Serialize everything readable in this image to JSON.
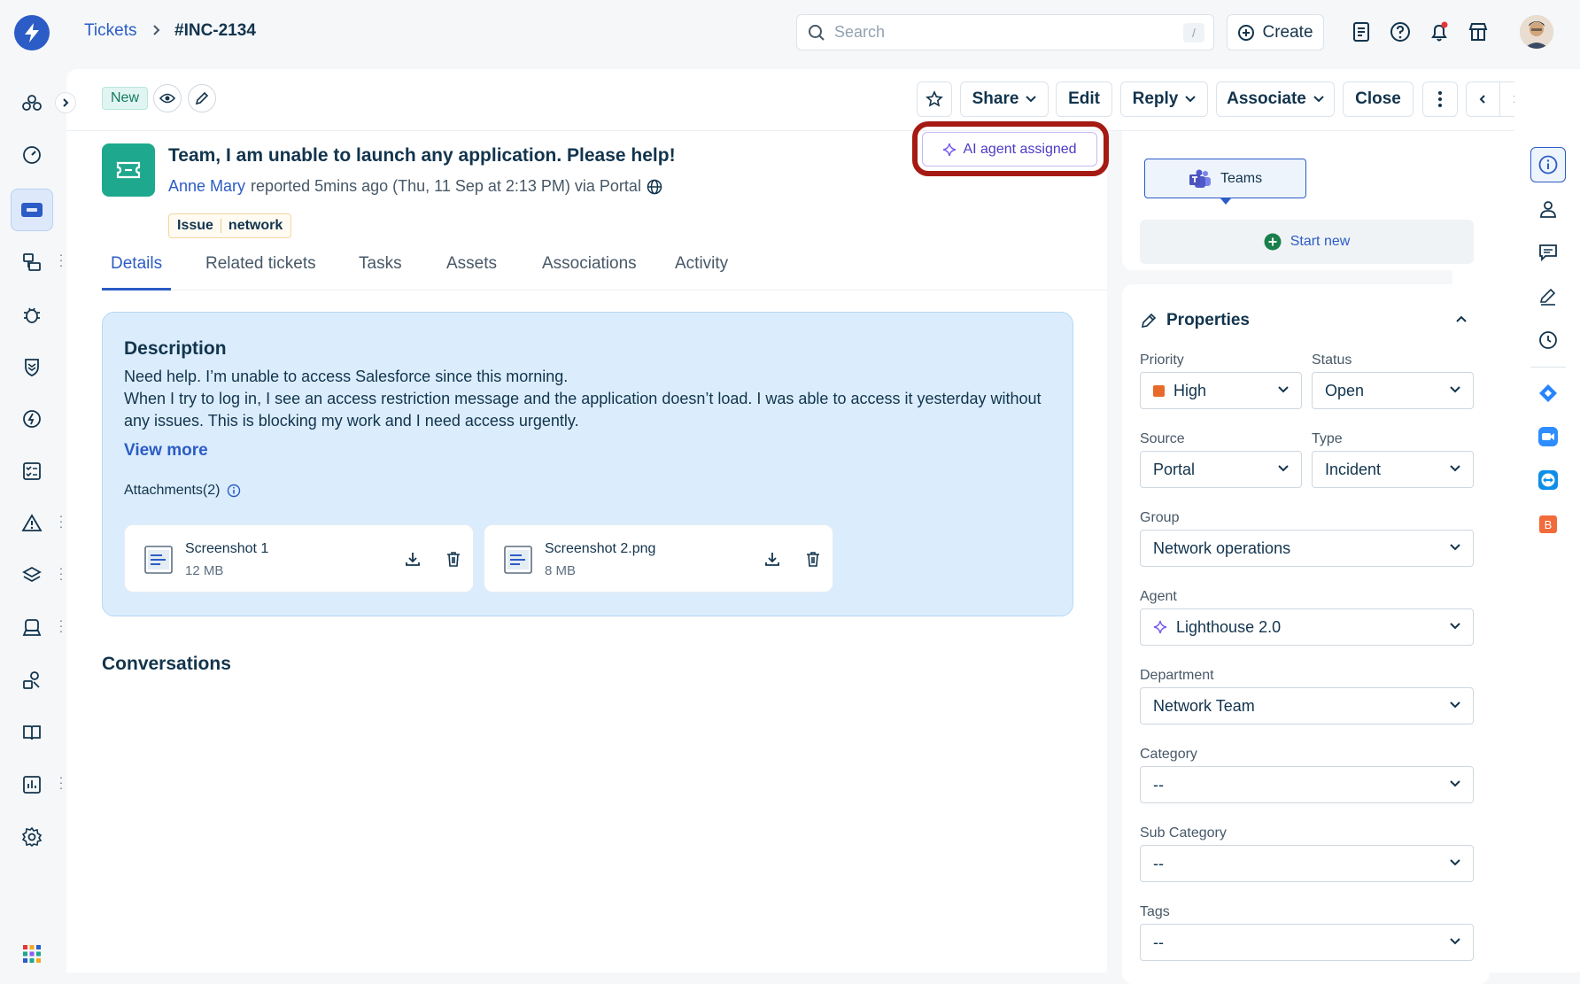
{
  "breadcrumb": {
    "parent": "Tickets",
    "current": "#INC-2134"
  },
  "search": {
    "placeholder": "Search",
    "shortcut": "/"
  },
  "header": {
    "create_label": "Create"
  },
  "actionbar": {
    "status": "New",
    "share": "Share",
    "edit": "Edit",
    "reply": "Reply",
    "associate": "Associate",
    "close": "Close"
  },
  "ticket": {
    "subject": "Team, I am unable to launch any application. Please help!",
    "requester": "Anne Mary",
    "reported_text": "reported 5mins ago (Thu, 11 Sep at 2:13 PM) via Portal",
    "tags": [
      "Issue",
      "network"
    ],
    "ai_badge": "AI agent assigned"
  },
  "tabs": [
    "Details",
    "Related tickets",
    "Tasks",
    "Assets",
    "Associations",
    "Activity"
  ],
  "description": {
    "title": "Description",
    "line1": "Need help. I’m unable to access Salesforce since this morning.",
    "line2": "When I try to log in, I see an access restriction message and the application doesn’t load. I was able to access it yesterday without any issues. This is blocking my work and I need access urgently.",
    "view_more": "View more",
    "attachments_label": "Attachments(2)",
    "attachments": [
      {
        "name": "Screenshot 1",
        "size": "12 MB"
      },
      {
        "name": "Screenshot 2.png",
        "size": "8 MB"
      }
    ]
  },
  "conversations_title": "Conversations",
  "collaborate": {
    "teams_label": "Teams",
    "start_new": "Start new"
  },
  "properties": {
    "title": "Properties",
    "priority": {
      "label": "Priority",
      "value": "High",
      "color": "#e86a2a"
    },
    "status": {
      "label": "Status",
      "value": "Open"
    },
    "source": {
      "label": "Source",
      "value": "Portal"
    },
    "type": {
      "label": "Type",
      "value": "Incident"
    },
    "group": {
      "label": "Group",
      "value": "Network operations"
    },
    "agent": {
      "label": "Agent",
      "value": "Lighthouse 2.0"
    },
    "department": {
      "label": "Department",
      "value": "Network Team"
    },
    "category": {
      "label": "Category",
      "value": "--"
    },
    "sub_category": {
      "label": "Sub Category",
      "value": "--"
    },
    "tags": {
      "label": "Tags",
      "value": "--"
    }
  },
  "colors": {
    "brand": "#2c5cc5",
    "highlight_ring": "#a51a12",
    "ai": "#4d3ac5",
    "ticket_icon": "#1ea88d"
  },
  "icons": {
    "sidebar": [
      "bots-icon",
      "dashboard-icon",
      "tickets-icon",
      "problems-icon",
      "bug-icon",
      "shield-icon",
      "changes-icon",
      "tasks-icon",
      "alerts-icon",
      "layers-icon",
      "service-catalog-icon",
      "assets-icon",
      "knowledge-book-icon",
      "reports-icon",
      "settings-icon",
      "apps-grid-icon"
    ],
    "right_rail": [
      "info-icon",
      "contact-icon",
      "conversation-icon",
      "notes-icon",
      "history-icon",
      "jira-icon",
      "zoom-icon",
      "teamviewer-icon",
      "app-b-icon"
    ]
  }
}
